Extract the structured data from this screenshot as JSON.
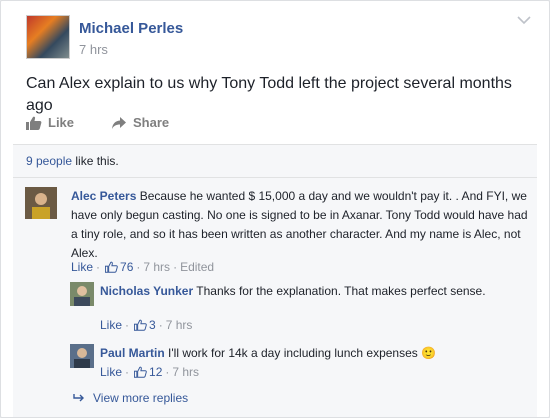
{
  "post": {
    "author": "Michael Perles",
    "time": "7 hrs",
    "text": "Can Alex explain to us why Tony Todd left the project several months ago",
    "actions": {
      "like": "Like",
      "share": "Share"
    }
  },
  "likes_summary": {
    "people": "9 people",
    "suffix": " like this."
  },
  "comments": [
    {
      "author": "Alec Peters",
      "text": " Because he wanted $ 15,000 a day and we wouldn't pay it. . And FYI, we have only begun casting. No one is signed to be in Axanar. Tony Todd would have had a tiny role, and so it has been written as another character. And my name is Alec, not Alex.",
      "like": "Like",
      "likes": "76",
      "time": "7 hrs",
      "edited": "Edited"
    }
  ],
  "replies": [
    {
      "author": "Nicholas Yunker",
      "text": " Thanks for the explanation. That makes perfect sense.",
      "like": "Like",
      "likes": "3",
      "time": "7 hrs"
    },
    {
      "author": "Paul Martin",
      "text": " I'll work for 14k a day including lunch expenses",
      "emoji": "🙂",
      "like": "Like",
      "likes": "12",
      "time": "7 hrs"
    }
  ],
  "view_more": "View more replies",
  "colors": {
    "link": "#365899",
    "meta": "#90949c",
    "text": "#1d2129"
  },
  "icons": [
    "chevron-down-icon",
    "thumbs-up-icon",
    "share-arrow-icon",
    "reply-arrow-icon",
    "smiley-emoji"
  ]
}
